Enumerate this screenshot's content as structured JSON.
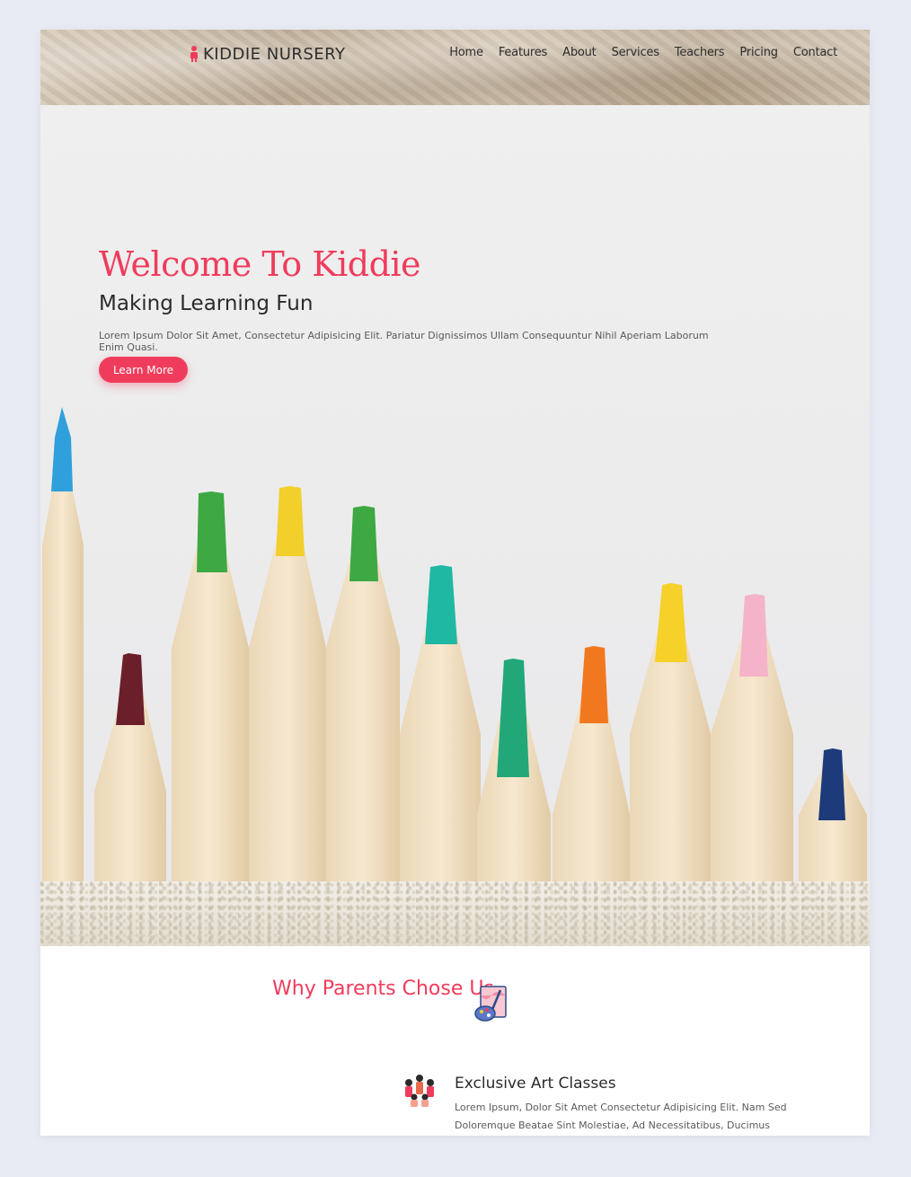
{
  "brand": {
    "name": "KIDDIE NURSERY",
    "icon": "person-icon",
    "icon_color": "#f03c5c"
  },
  "nav": {
    "items": [
      {
        "label": "Home"
      },
      {
        "label": "Features"
      },
      {
        "label": "About"
      },
      {
        "label": "Services"
      },
      {
        "label": "Teachers"
      },
      {
        "label": "Pricing"
      },
      {
        "label": "Contact"
      }
    ]
  },
  "hero": {
    "title": "Welcome To Kiddie",
    "subtitle": "Making Learning Fun",
    "text": "Lorem Ipsum Dolor Sit Amet, Consectetur Adipisicing Elit. Pariatur Dignissimos Ullam Consequuntur Nihil Aperiam Laborum Enim Quasi.",
    "button_label": "Learn More",
    "background": "colored-pencils-photo"
  },
  "why": {
    "title": "Why Parents Chose Us",
    "title_icon": "palette-brush-icon"
  },
  "features": [
    {
      "icon": "kids-group-icon",
      "title": "Exclusive Art Classes",
      "text": "Lorem Ipsum, Dolor Sit Amet Consectetur Adipisicing Elit. Nam Sed Doloremque Beatae Sint Molestiae, Ad Necessitatibus, Ducimus Adipisci Aspernatur Voluptatem Ut!"
    }
  ],
  "colors": {
    "accent": "#f03c5c",
    "text_dark": "#2b2b2b",
    "page_bg": "#e8ebf3"
  }
}
